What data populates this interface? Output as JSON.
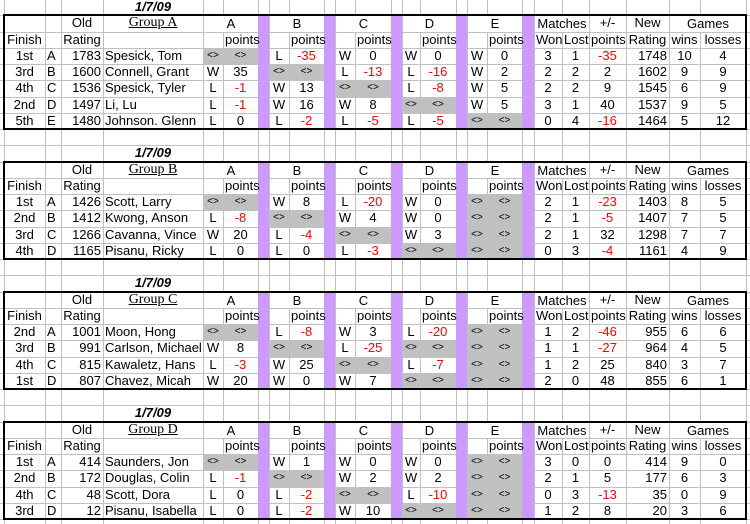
{
  "colors": {
    "grid": "#c0c0c0",
    "separator": "#cc99ff",
    "self_match": "#c0c0c0",
    "negative": "#ff0000"
  },
  "headers": {
    "old": "Old",
    "finish": "Finish",
    "rating": "Rating",
    "opponents": [
      "A",
      "B",
      "C",
      "D",
      "E"
    ],
    "points": "points",
    "matches": "Matches",
    "won": "Won",
    "lost": "Lost",
    "plusminus": "+/-",
    "plusminus_points": "points",
    "new": "New",
    "new_rating": "Rating",
    "games": "Games",
    "wins": "wins",
    "losses": "losses"
  },
  "groups": [
    {
      "date": "1/7/09",
      "title": "Group A",
      "rows": [
        {
          "finish": "1st",
          "letter": "A",
          "rating": "1783",
          "name": "Spesick, Tom",
          "results": [
            {
              "wl": "<>",
              "pts": "<>"
            },
            {
              "wl": "L",
              "pts": "-35"
            },
            {
              "wl": "W",
              "pts": "0"
            },
            {
              "wl": "W",
              "pts": "0"
            },
            {
              "wl": "W",
              "pts": "0"
            }
          ],
          "won": "3",
          "lost": "1",
          "pm": "-35",
          "new_rating": "1748",
          "wins": "10",
          "losses": "4"
        },
        {
          "finish": "3rd",
          "letter": "B",
          "rating": "1600",
          "name": "Connell, Grant",
          "results": [
            {
              "wl": "W",
              "pts": "35"
            },
            {
              "wl": "<>",
              "pts": "<>"
            },
            {
              "wl": "L",
              "pts": "-13"
            },
            {
              "wl": "L",
              "pts": "-16"
            },
            {
              "wl": "W",
              "pts": "2"
            }
          ],
          "won": "2",
          "lost": "2",
          "pm": "2",
          "new_rating": "1602",
          "wins": "9",
          "losses": "9"
        },
        {
          "finish": "4th",
          "letter": "C",
          "rating": "1536",
          "name": "Spesick, Tyler",
          "results": [
            {
              "wl": "L",
              "pts": "-1"
            },
            {
              "wl": "W",
              "pts": "13"
            },
            {
              "wl": "<>",
              "pts": "<>"
            },
            {
              "wl": "L",
              "pts": "-8"
            },
            {
              "wl": "W",
              "pts": "5"
            }
          ],
          "won": "2",
          "lost": "2",
          "pm": "9",
          "new_rating": "1545",
          "wins": "6",
          "losses": "9"
        },
        {
          "finish": "2nd",
          "letter": "D",
          "rating": "1497",
          "name": "Li, Lu",
          "results": [
            {
              "wl": "L",
              "pts": "-1"
            },
            {
              "wl": "W",
              "pts": "16"
            },
            {
              "wl": "W",
              "pts": "8"
            },
            {
              "wl": "<>",
              "pts": "<>"
            },
            {
              "wl": "W",
              "pts": "5"
            }
          ],
          "won": "3",
          "lost": "1",
          "pm": "40",
          "new_rating": "1537",
          "wins": "9",
          "losses": "5"
        },
        {
          "finish": "5th",
          "letter": "E",
          "rating": "1480",
          "name": "Johnson. Glenn",
          "results": [
            {
              "wl": "L",
              "pts": "0"
            },
            {
              "wl": "L",
              "pts": "-2"
            },
            {
              "wl": "L",
              "pts": "-5"
            },
            {
              "wl": "L",
              "pts": "-5"
            },
            {
              "wl": "<>",
              "pts": "<>"
            }
          ],
          "won": "0",
          "lost": "4",
          "pm": "-16",
          "new_rating": "1464",
          "wins": "5",
          "losses": "12"
        }
      ]
    },
    {
      "date": "1/7/09",
      "title": "Group B",
      "rows": [
        {
          "finish": "1st",
          "letter": "A",
          "rating": "1426",
          "name": "Scott, Larry",
          "results": [
            {
              "wl": "<>",
              "pts": "<>"
            },
            {
              "wl": "W",
              "pts": "8"
            },
            {
              "wl": "L",
              "pts": "-20"
            },
            {
              "wl": "W",
              "pts": "0"
            },
            {
              "wl": "<>",
              "pts": "<>"
            }
          ],
          "won": "2",
          "lost": "1",
          "pm": "-23",
          "new_rating": "1403",
          "wins": "8",
          "losses": "5"
        },
        {
          "finish": "2nd",
          "letter": "B",
          "rating": "1412",
          "name": "Kwong, Anson",
          "results": [
            {
              "wl": "L",
              "pts": "-8"
            },
            {
              "wl": "<>",
              "pts": "<>"
            },
            {
              "wl": "W",
              "pts": "4"
            },
            {
              "wl": "W",
              "pts": "0"
            },
            {
              "wl": "<>",
              "pts": "<>"
            }
          ],
          "won": "2",
          "lost": "1",
          "pm": "-5",
          "new_rating": "1407",
          "wins": "7",
          "losses": "5"
        },
        {
          "finish": "3rd",
          "letter": "C",
          "rating": "1266",
          "name": "Cavanna, Vince",
          "results": [
            {
              "wl": "W",
              "pts": "20"
            },
            {
              "wl": "L",
              "pts": "-4"
            },
            {
              "wl": "<>",
              "pts": "<>"
            },
            {
              "wl": "W",
              "pts": "3"
            },
            {
              "wl": "<>",
              "pts": "<>"
            }
          ],
          "won": "2",
          "lost": "1",
          "pm": "32",
          "new_rating": "1298",
          "wins": "7",
          "losses": "7"
        },
        {
          "finish": "4th",
          "letter": "D",
          "rating": "1165",
          "name": "Pisanu, Ricky",
          "results": [
            {
              "wl": "L",
              "pts": "0"
            },
            {
              "wl": "L",
              "pts": "0"
            },
            {
              "wl": "L",
              "pts": "-3"
            },
            {
              "wl": "<>",
              "pts": "<>"
            },
            {
              "wl": "<>",
              "pts": "<>"
            }
          ],
          "won": "0",
          "lost": "3",
          "pm": "-4",
          "new_rating": "1161",
          "wins": "4",
          "losses": "9"
        }
      ]
    },
    {
      "date": "1/7/09",
      "title": "Group C",
      "rows": [
        {
          "finish": "2nd",
          "letter": "A",
          "rating": "1001",
          "name": "Moon, Hong",
          "results": [
            {
              "wl": "<>",
              "pts": "<>"
            },
            {
              "wl": "L",
              "pts": "-8"
            },
            {
              "wl": "W",
              "pts": "3"
            },
            {
              "wl": "L",
              "pts": "-20"
            },
            {
              "wl": "<>",
              "pts": "<>"
            }
          ],
          "won": "1",
          "lost": "2",
          "pm": "-46",
          "new_rating": "955",
          "wins": "6",
          "losses": "6"
        },
        {
          "finish": "3rd",
          "letter": "B",
          "rating": "991",
          "name": "Carlson, Michael",
          "results": [
            {
              "wl": "W",
              "pts": "8"
            },
            {
              "wl": "<>",
              "pts": "<>"
            },
            {
              "wl": "L",
              "pts": "-25"
            },
            {
              "wl": "<>",
              "pts": "<>"
            },
            {
              "wl": "<>",
              "pts": "<>"
            }
          ],
          "won": "1",
          "lost": "1",
          "pm": "-27",
          "new_rating": "964",
          "wins": "4",
          "losses": "5"
        },
        {
          "finish": "4th",
          "letter": "C",
          "rating": "815",
          "name": "Kawaletz, Hans",
          "results": [
            {
              "wl": "L",
              "pts": "-3"
            },
            {
              "wl": "W",
              "pts": "25"
            },
            {
              "wl": "<>",
              "pts": "<>"
            },
            {
              "wl": "L",
              "pts": "-7"
            },
            {
              "wl": "<>",
              "pts": "<>"
            }
          ],
          "won": "1",
          "lost": "2",
          "pm": "25",
          "new_rating": "840",
          "wins": "3",
          "losses": "7"
        },
        {
          "finish": "1st",
          "letter": "D",
          "rating": "807",
          "name": "Chavez, Micah",
          "results": [
            {
              "wl": "W",
              "pts": "20"
            },
            {
              "wl": "W",
              "pts": "0"
            },
            {
              "wl": "W",
              "pts": "7"
            },
            {
              "wl": "<>",
              "pts": "<>"
            },
            {
              "wl": "<>",
              "pts": "<>"
            }
          ],
          "won": "2",
          "lost": "0",
          "pm": "48",
          "new_rating": "855",
          "wins": "6",
          "losses": "1"
        }
      ]
    },
    {
      "date": "1/7/09",
      "title": "Group D",
      "rows": [
        {
          "finish": "1st",
          "letter": "A",
          "rating": "414",
          "name": "Saunders, Jon",
          "results": [
            {
              "wl": "<>",
              "pts": "<>"
            },
            {
              "wl": "W",
              "pts": "1"
            },
            {
              "wl": "W",
              "pts": "0"
            },
            {
              "wl": "W",
              "pts": "0"
            },
            {
              "wl": "<>",
              "pts": "<>"
            }
          ],
          "won": "3",
          "lost": "0",
          "pm": "0",
          "new_rating": "414",
          "wins": "9",
          "losses": "0"
        },
        {
          "finish": "2nd",
          "letter": "B",
          "rating": "172",
          "name": "Douglas, Colin",
          "results": [
            {
              "wl": "L",
              "pts": "-1"
            },
            {
              "wl": "<>",
              "pts": "<>"
            },
            {
              "wl": "W",
              "pts": "2"
            },
            {
              "wl": "W",
              "pts": "2"
            },
            {
              "wl": "<>",
              "pts": "<>"
            }
          ],
          "won": "2",
          "lost": "1",
          "pm": "5",
          "new_rating": "177",
          "wins": "6",
          "losses": "3"
        },
        {
          "finish": "4th",
          "letter": "C",
          "rating": "48",
          "name": "Scott, Dora",
          "results": [
            {
              "wl": "L",
              "pts": "0"
            },
            {
              "wl": "L",
              "pts": "-2"
            },
            {
              "wl": "<>",
              "pts": "<>"
            },
            {
              "wl": "L",
              "pts": "-10"
            },
            {
              "wl": "<>",
              "pts": "<>"
            }
          ],
          "won": "0",
          "lost": "3",
          "pm": "-13",
          "new_rating": "35",
          "wins": "0",
          "losses": "9"
        },
        {
          "finish": "3rd",
          "letter": "D",
          "rating": "12",
          "name": "Pisanu, Isabella",
          "results": [
            {
              "wl": "L",
              "pts": "0"
            },
            {
              "wl": "L",
              "pts": "-2"
            },
            {
              "wl": "W",
              "pts": "10"
            },
            {
              "wl": "<>",
              "pts": "<>"
            },
            {
              "wl": "<>",
              "pts": "<>"
            }
          ],
          "won": "1",
          "lost": "2",
          "pm": "8",
          "new_rating": "20",
          "wins": "3",
          "losses": "6"
        }
      ]
    }
  ]
}
